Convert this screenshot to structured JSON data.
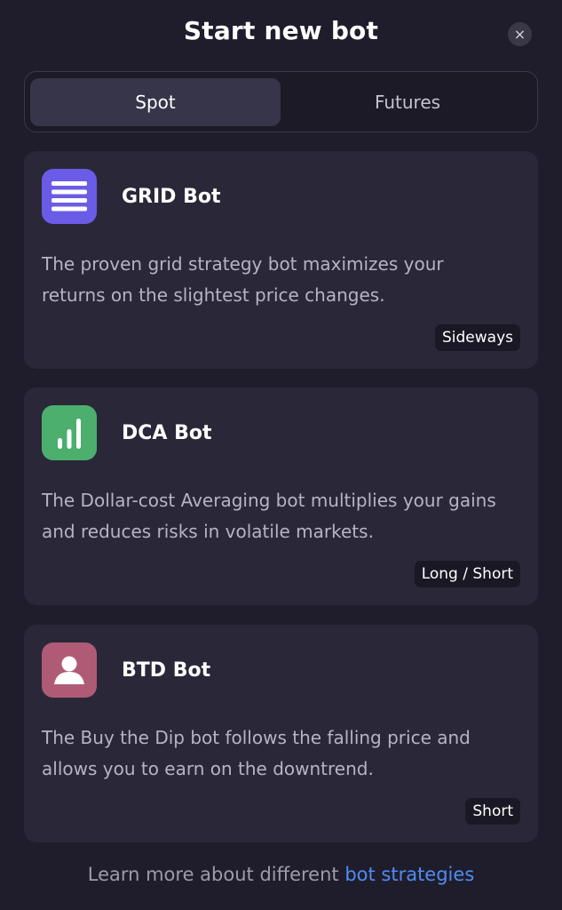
{
  "modal": {
    "title": "Start new bot",
    "close_icon": "close-icon",
    "close_glyph": "×"
  },
  "tabs": [
    {
      "label": "Spot",
      "active": true
    },
    {
      "label": "Futures",
      "active": false
    }
  ],
  "bots": [
    {
      "name": "GRID Bot",
      "icon": "grid-lines-icon",
      "icon_color": "#6b5ce7",
      "description": "The proven grid strategy bot maximizes your returns on the slightest price changes.",
      "tag": "Sideways"
    },
    {
      "name": "DCA Bot",
      "icon": "bar-chart-icon",
      "icon_color": "#4caf6e",
      "description": "The Dollar-cost Averaging bot multiplies your gains and reduces risks in volatile markets.",
      "tag": "Long / Short"
    },
    {
      "name": "BTD Bot",
      "icon": "person-icon",
      "icon_color": "#b05b75",
      "description": "The Buy the Dip bot follows the falling price and allows you to earn on the downtrend.",
      "tag": "Short"
    }
  ],
  "footer": {
    "text": "Learn more about different ",
    "link": "bot strategies"
  },
  "colors": {
    "background": "#1f1d2b",
    "card": "#2a2838",
    "link": "#4f8cf3"
  }
}
